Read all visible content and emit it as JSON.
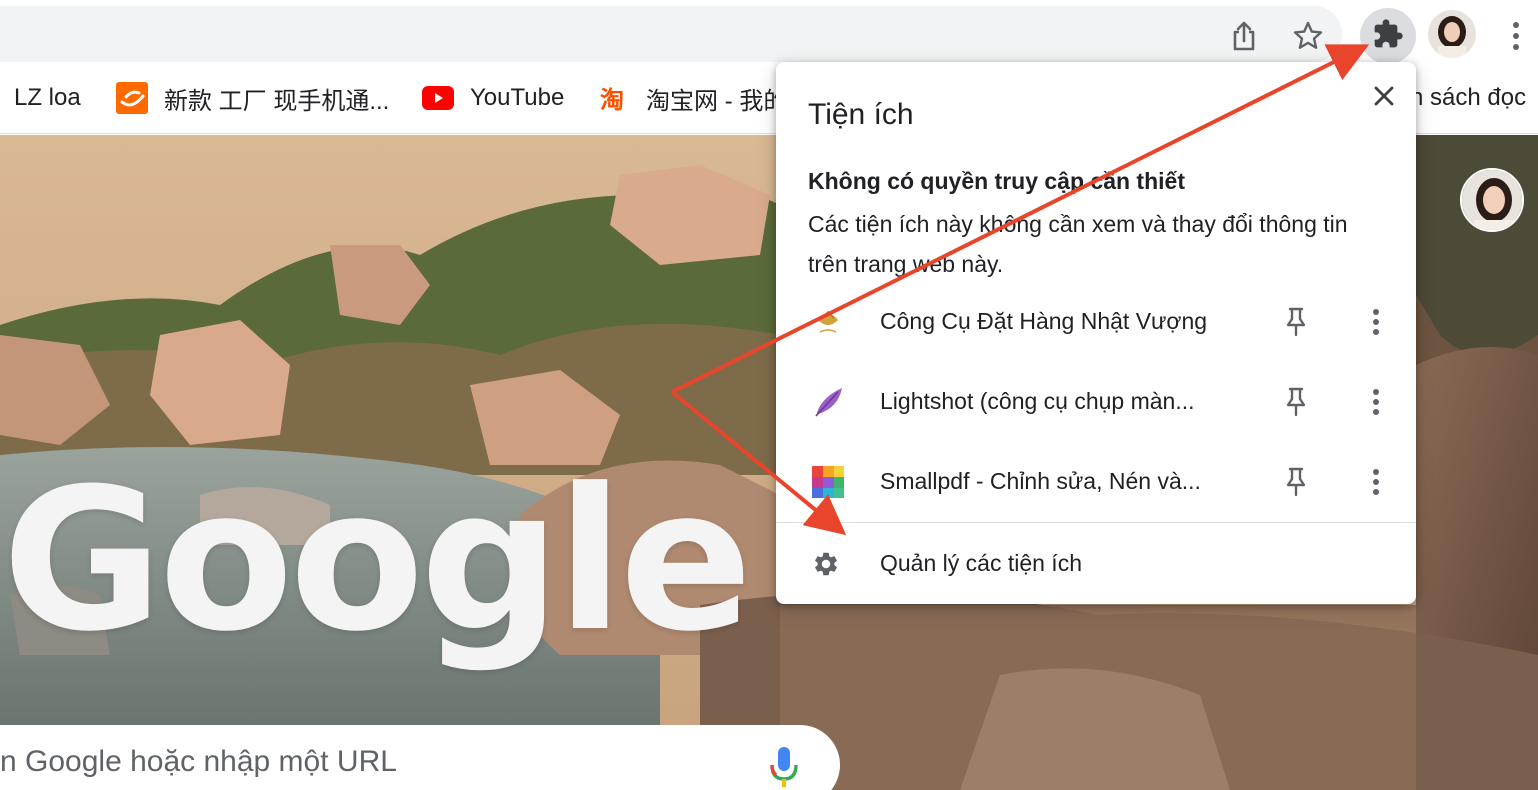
{
  "toolbar": {
    "share_icon": "share-icon",
    "bookmark_icon": "star-icon",
    "extensions_icon": "puzzle-icon",
    "menu_icon": "kebab-menu-icon"
  },
  "bookmarks": [
    {
      "label": "LZ loa",
      "icon": "none"
    },
    {
      "label": "新款 工厂 现手机通...",
      "icon": "alibaba-icon"
    },
    {
      "label": "YouTube",
      "icon": "youtube-icon"
    },
    {
      "label": "淘宝网 - 我的",
      "icon": "taobao-icon"
    },
    {
      "label": "n sách đọc",
      "icon": "none"
    }
  ],
  "ntp": {
    "logo_text": "Google",
    "search_placeholder": "n Google hoặc nhập một URL"
  },
  "popup": {
    "title": "Tiện ích",
    "section_title": "Không có quyền truy cập cần thiết",
    "section_desc": "Các tiện ích này không cần xem và thay đổi thông tin trên trang web này.",
    "extensions": [
      {
        "name": "Công Cụ Đặt Hàng Nhật Vượng",
        "icon": "nhat-vuong-logo"
      },
      {
        "name": "Lightshot (công cụ chụp màn...",
        "icon": "feather-icon"
      },
      {
        "name": "Smallpdf - Chỉnh sửa, Nén và...",
        "icon": "smallpdf-icon"
      }
    ],
    "manage_label": "Quản lý các tiện ích"
  },
  "colors": {
    "accent_arrow": "#e8452c",
    "toolbar_bg": "#f1f3f4",
    "ext_button_active": "#dadce0",
    "text": "#202124"
  }
}
